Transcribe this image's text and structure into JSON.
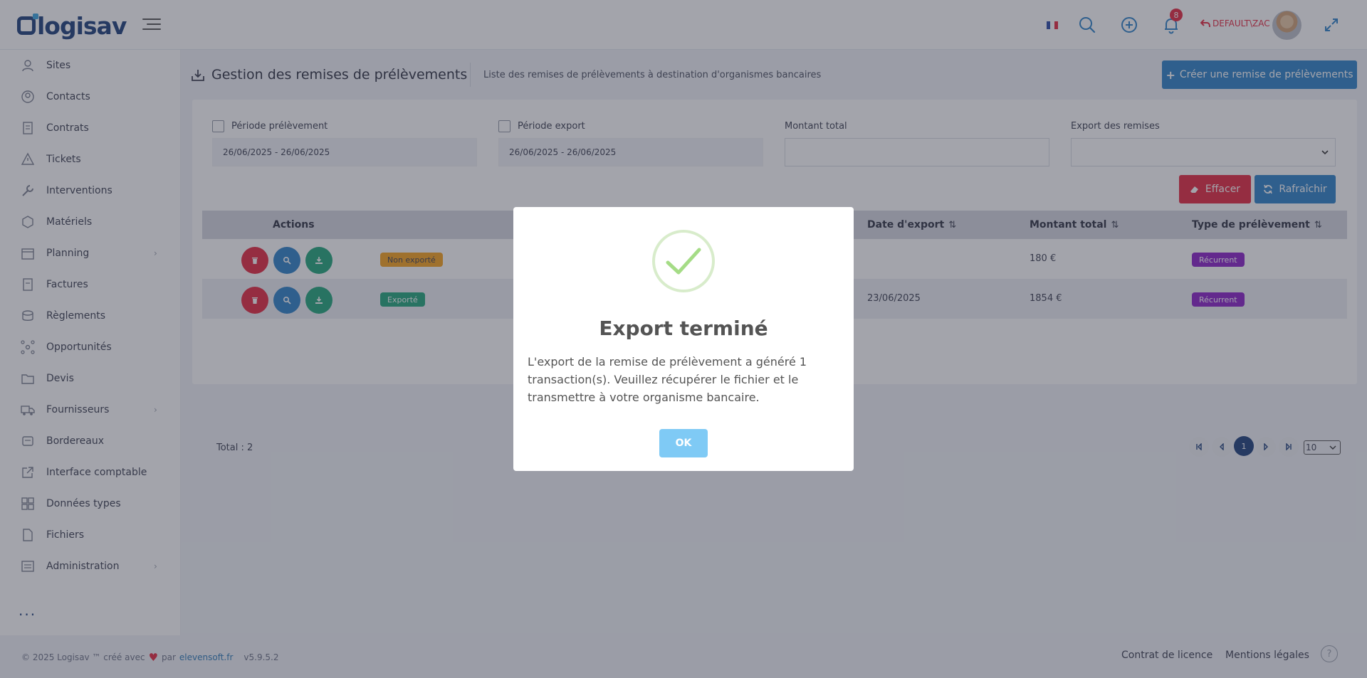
{
  "header": {
    "logo_text": "logisav",
    "notifications_count": "8",
    "user_name": "DEFAULT\\ZAC",
    "language": "fr"
  },
  "sidebar": {
    "items": [
      {
        "label": "Sites",
        "icon": "user-location-icon",
        "has_submenu": false
      },
      {
        "label": "Contacts",
        "icon": "contact-icon",
        "has_submenu": false
      },
      {
        "label": "Contrats",
        "icon": "contract-icon",
        "has_submenu": false
      },
      {
        "label": "Tickets",
        "icon": "warning-icon",
        "has_submenu": false
      },
      {
        "label": "Interventions",
        "icon": "wrench-icon",
        "has_submenu": false
      },
      {
        "label": "Matériels",
        "icon": "box-icon",
        "has_submenu": false
      },
      {
        "label": "Planning",
        "icon": "calendar-icon",
        "has_submenu": true
      },
      {
        "label": "Factures",
        "icon": "invoice-icon",
        "has_submenu": false
      },
      {
        "label": "Règlements",
        "icon": "coins-icon",
        "has_submenu": false
      },
      {
        "label": "Opportunités",
        "icon": "network-icon",
        "has_submenu": false
      },
      {
        "label": "Devis",
        "icon": "folder-icon",
        "has_submenu": false
      },
      {
        "label": "Fournisseurs",
        "icon": "truck-icon",
        "has_submenu": true
      },
      {
        "label": "Bordereaux",
        "icon": "stamp-icon",
        "has_submenu": false
      },
      {
        "label": "Interface comptable",
        "icon": "external-link-icon",
        "has_submenu": false
      },
      {
        "label": "Données types",
        "icon": "grid-icon",
        "has_submenu": false
      },
      {
        "label": "Fichiers",
        "icon": "file-icon",
        "has_submenu": false
      },
      {
        "label": "Administration",
        "icon": "settings-list-icon",
        "has_submenu": true
      }
    ],
    "more_label": "..."
  },
  "page": {
    "title": "Gestion des remises de prélèvements",
    "subtitle": "Liste des remises de prélèvements à destination d'organismes bancaires",
    "create_button": "Créer une remise de prélèvements"
  },
  "filters": {
    "periode_prelevement": {
      "label": "Période prélèvement",
      "value": "26/06/2025 - 26/06/2025"
    },
    "periode_export": {
      "label": "Période export",
      "value": "26/06/2025 - 26/06/2025"
    },
    "montant_total": {
      "label": "Montant total",
      "value": ""
    },
    "export_remises": {
      "label": "Export des remises",
      "value": ""
    },
    "clear_button": "Effacer",
    "refresh_button": "Rafraîchir"
  },
  "table": {
    "headers": {
      "actions": "Actions",
      "date_export": "Date d'export",
      "montant_total": "Montant total",
      "type": "Type de prélèvement"
    },
    "rows": [
      {
        "status": "Non exporté",
        "date_export": "",
        "montant": "180 €",
        "type": "Récurrent"
      },
      {
        "status": "Exporté",
        "date_export": "23/06/2025",
        "montant": "1854 €",
        "type": "Récurrent"
      }
    ],
    "total": "Total : 2",
    "page": "1",
    "page_size": "10"
  },
  "modal": {
    "title": "Export terminé",
    "text": "L'export de la remise de prélèvement a généré 1 transaction(s). Veuillez récupérer le fichier et le transmettre à votre organisme bancaire.",
    "ok": "OK"
  },
  "footer": {
    "copyright": "© 2025 Logisav ™ créé avec",
    "par": "par",
    "link": "elevensoft.fr",
    "version": "v5.9.5.2",
    "license": "Contrat de licence",
    "legal": "Mentions légales",
    "help": "?"
  },
  "colors": {
    "primary": "#2c82c9",
    "danger": "#e6273f",
    "success": "#1fa67a",
    "warning": "#f7a21b",
    "purple": "#8a1fc9",
    "brand": "#1d3f7a"
  }
}
